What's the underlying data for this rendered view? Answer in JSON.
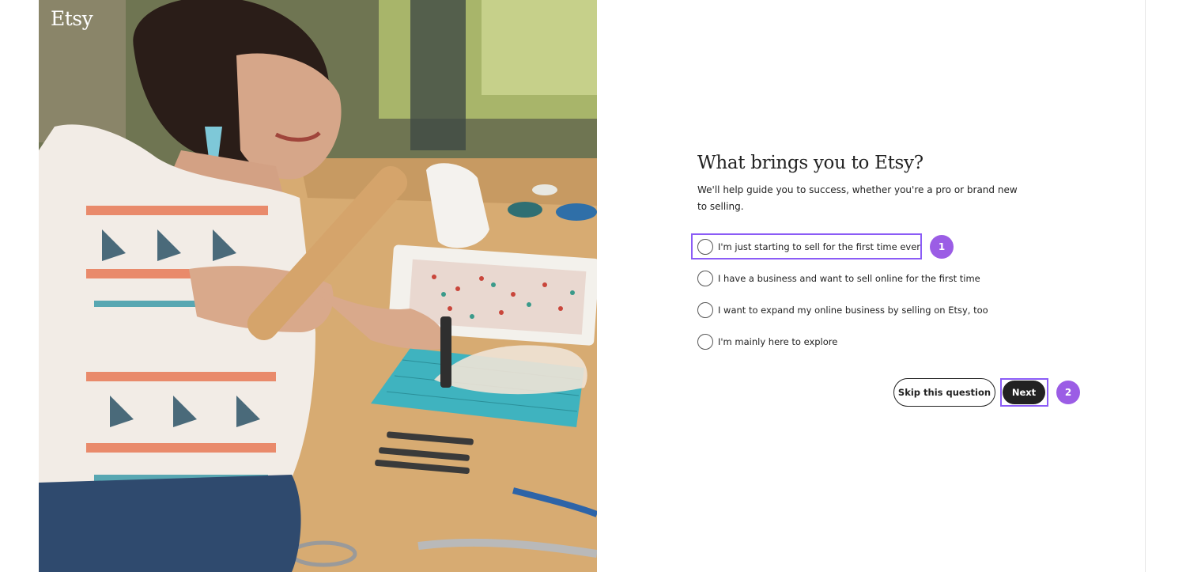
{
  "brand": {
    "logo_text": "Etsy"
  },
  "question": {
    "title": "What brings you to Etsy?",
    "subtitle": "We'll help guide you to success, whether you're a pro or brand new to selling."
  },
  "options": [
    {
      "label": "I'm just starting to sell for the first time ever",
      "selected": false
    },
    {
      "label": "I have a business and want to sell online for the first time",
      "selected": false
    },
    {
      "label": "I want to expand my online business by selling on Etsy, too",
      "selected": false
    },
    {
      "label": "I'm mainly here to explore",
      "selected": false
    }
  ],
  "actions": {
    "skip_label": "Skip this question",
    "next_label": "Next"
  },
  "annotations": {
    "step_1": "1",
    "step_2": "2",
    "highlight_color": "#8b5cf6",
    "badge_color": "#9b5de5"
  },
  "colors": {
    "text": "#222222",
    "primary_button": "#222222",
    "background": "#ffffff"
  }
}
